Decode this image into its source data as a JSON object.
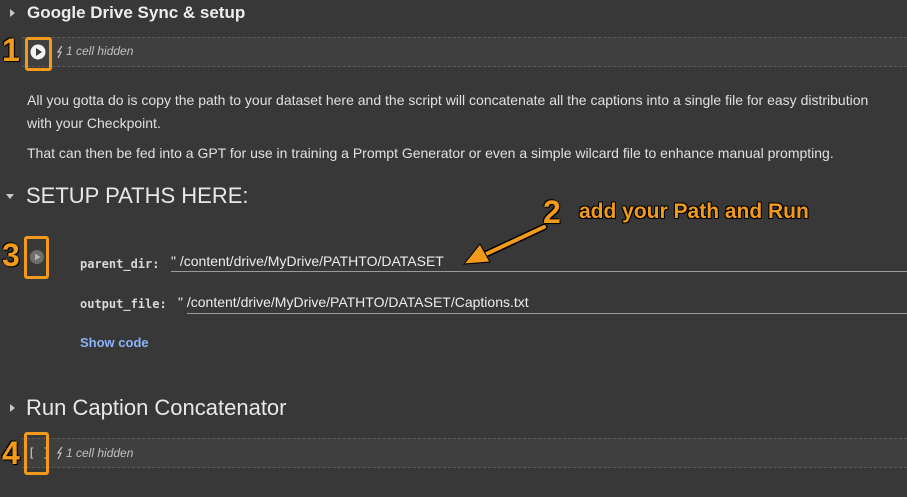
{
  "section1": {
    "title": "Google Drive Sync & setup",
    "hidden_label": "1 cell hidden"
  },
  "text_cell": {
    "line1": "All you gotta do is copy the path to your dataset here and the script will concatenate all the captions into a single file for easy distribution",
    "line2": "with your Checkpoint.",
    "line3": "That can then be fed into a GPT for use in training a Prompt Generator or even a simple wilcard file to enhance manual prompting."
  },
  "section2": {
    "title": "SETUP PATHS HERE:",
    "fields": [
      {
        "label": "parent_dir:",
        "value": "\" /content/drive/MyDrive/PATHTO/DATASET"
      },
      {
        "label": "output_file:",
        "value": "\" /content/drive/MyDrive/PATHTO/DATASET/Captions.txt"
      }
    ],
    "show_code": "Show code"
  },
  "section3": {
    "title": "Run Caption Concatenator",
    "hidden_label": "1 cell hidden"
  },
  "annotations": {
    "n1": "1",
    "n2": "2",
    "n3": "3",
    "n4": "4",
    "callout": "add your Path and Run"
  },
  "colors": {
    "accent": "#f29a1b",
    "link": "#8ab4f8",
    "background": "#383838"
  },
  "icons": [
    "caret-right-icon",
    "caret-down-icon",
    "play-icon",
    "hidden-cell-icon"
  ]
}
